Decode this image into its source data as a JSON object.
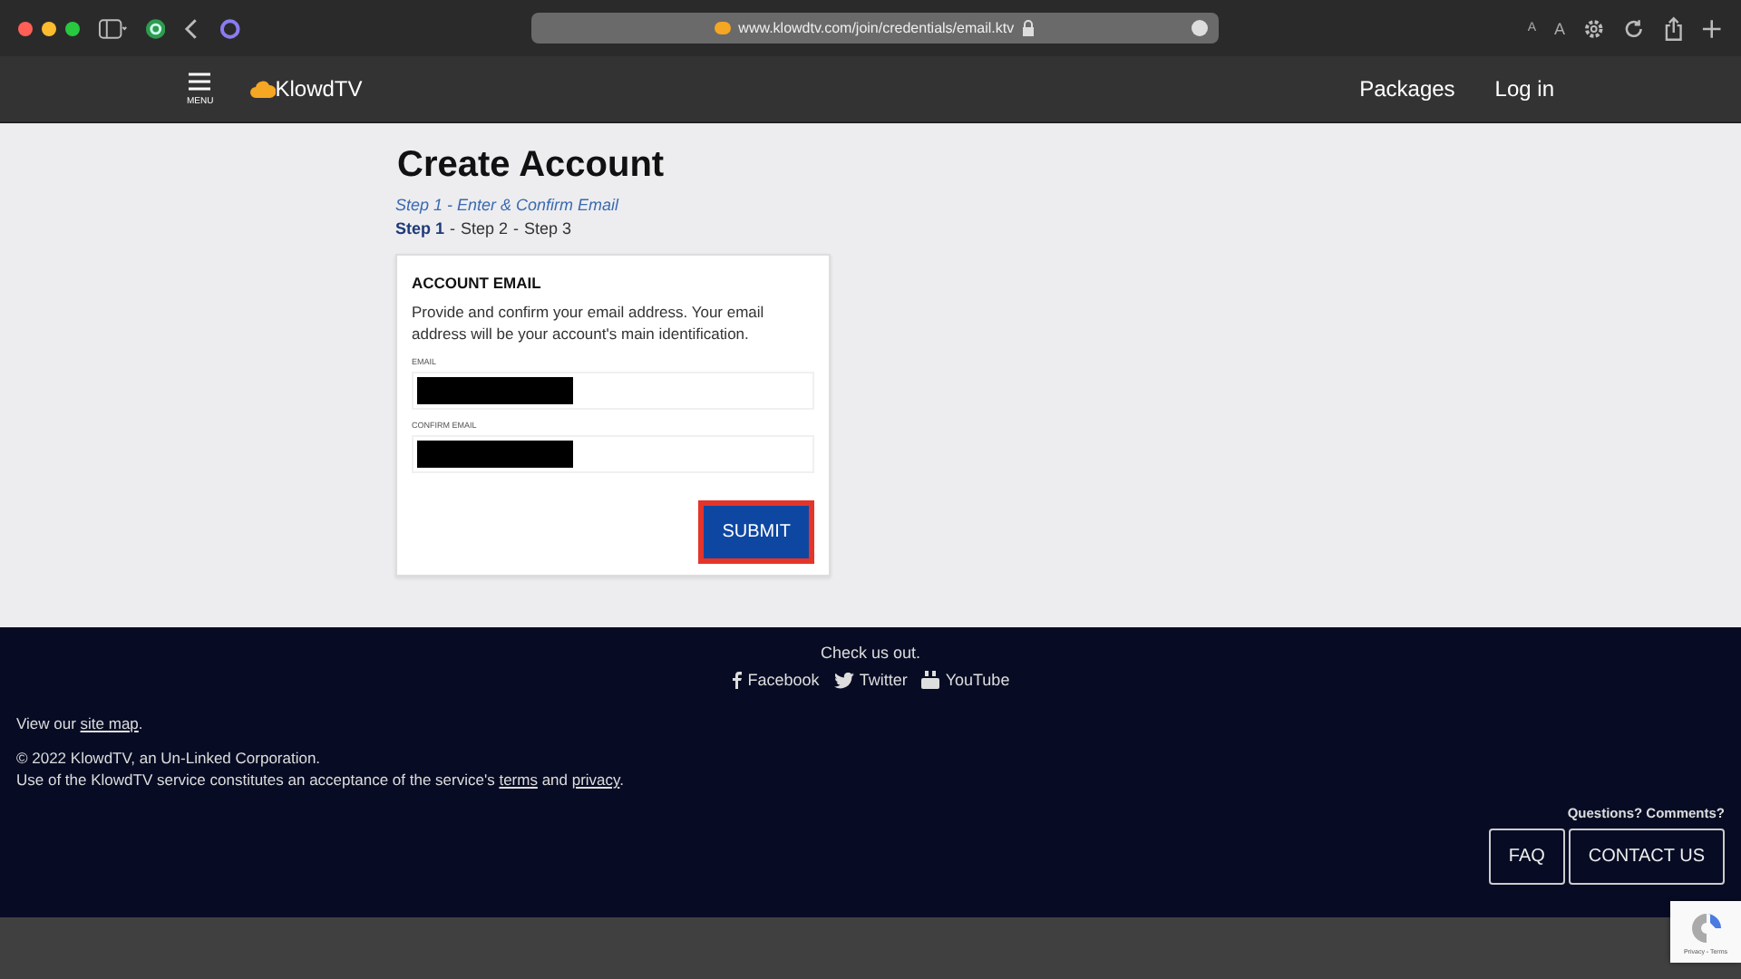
{
  "browser": {
    "url": "www.klowdtv.com/join/credentials/email.ktv",
    "font_small": "A",
    "font_large": "A"
  },
  "header": {
    "menu_label": "MENU",
    "logo": "KlowdTV",
    "nav": [
      "Packages",
      "Log in"
    ]
  },
  "page": {
    "title": "Create Account",
    "subtitle": "Step 1 - Enter & Confirm Email",
    "steps": [
      {
        "label": "Step 1",
        "selected": true
      },
      {
        "label": "Step 2",
        "selected": false
      },
      {
        "label": "Step 3",
        "selected": false
      }
    ],
    "step_separator": "-",
    "card": {
      "heading": "ACCOUNT EMAIL",
      "description": "Provide and confirm your email address. Your email address will be your account's main identification.",
      "fields": [
        {
          "label": "EMAIL",
          "redacted": true
        },
        {
          "label": "CONFIRM EMAIL",
          "redacted": true
        }
      ],
      "submit": "SUBMIT"
    }
  },
  "footer": {
    "check": "Check us out.",
    "social": [
      {
        "kind": "facebook",
        "label": "Facebook"
      },
      {
        "kind": "twitter",
        "label": "Twitter"
      },
      {
        "kind": "youtube",
        "label": "YouTube"
      }
    ],
    "sitemap": {
      "before": "View our ",
      "link": "site map",
      "after": "."
    },
    "copyright": "© 2022 KlowdTV, an Un-Linked Corporation.",
    "terms": {
      "before": "Use of the KlowdTV service constitutes an acceptance of the service's ",
      "link1": "terms",
      "middle": " and ",
      "link2": "privacy",
      "after": "."
    },
    "questions": "Questions? Comments?",
    "buttons": [
      "FAQ",
      "CONTACT US"
    ]
  },
  "recaptcha": {
    "text": "Privacy - Terms"
  }
}
